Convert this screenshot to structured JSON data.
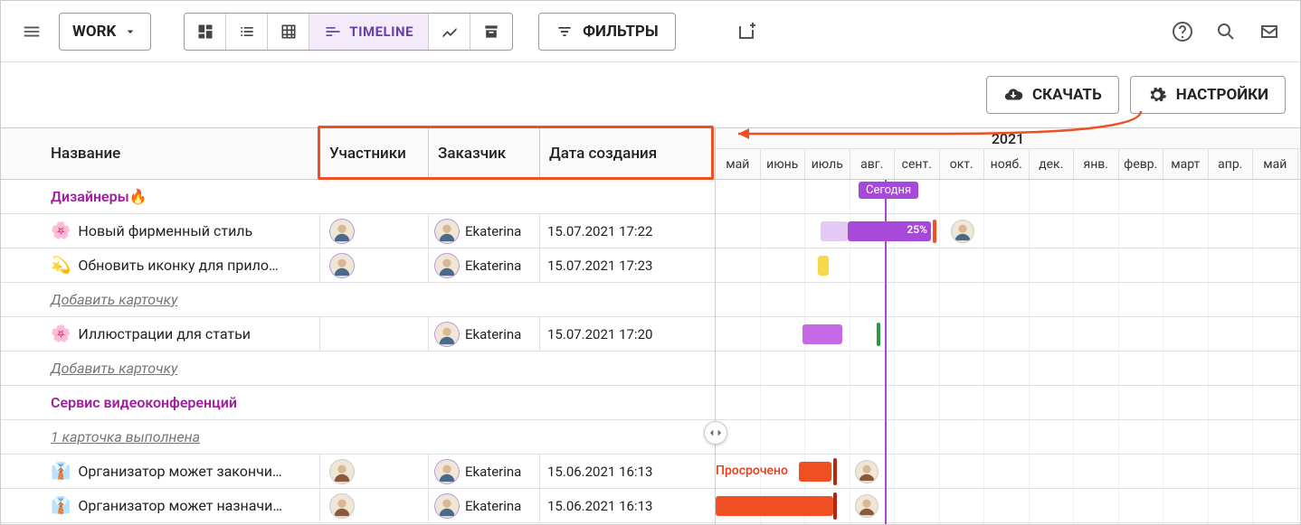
{
  "toolbar": {
    "project": "WORK",
    "timeline_label": "TIMELINE",
    "filters_label": "ФИЛЬТРЫ"
  },
  "actions": {
    "download": "СКАЧАТЬ",
    "settings": "НАСТРОЙКИ"
  },
  "headers": {
    "name": "Название",
    "participants": "Участники",
    "customer": "Заказчик",
    "created": "Дата создания"
  },
  "timeline": {
    "year": "2021",
    "months": [
      "май",
      "июнь",
      "июль",
      "авг.",
      "сент.",
      "окт.",
      "нояб.",
      "дек.",
      "янв.",
      "февр.",
      "март",
      "апр.",
      "май"
    ],
    "today_label": "Сегодня",
    "overdue_label": "Просрочено"
  },
  "sections": {
    "designers": "Дизайнеры🔥",
    "video": "Сервис видеоконференций"
  },
  "add_card": "Добавить карточку",
  "done_card": "1 карточка выполнена",
  "rows": {
    "r1": {
      "emoji": "🌸",
      "title": "Новый фирменный стиль",
      "customer": "Ekaterina",
      "created": "15.07.2021 17:22",
      "progress": "25%"
    },
    "r2": {
      "emoji": "💫",
      "title": "Обновить иконку для прило…",
      "customer": "Ekaterina",
      "created": "15.07.2021 17:23"
    },
    "r3": {
      "emoji": "🌸",
      "title": "Иллюстрации для статьи",
      "customer": "Ekaterina",
      "created": "15.07.2021 17:20"
    },
    "r4": {
      "emoji": "👔",
      "title": "Организатор может закончи…",
      "customer": "Ekaterina",
      "created": "15.06.2021 16:13"
    },
    "r5": {
      "emoji": "👔",
      "title": "Организатор может назначи…",
      "customer": "Ekaterina",
      "created": "15.06.2021 16:13"
    }
  },
  "colors": {
    "purple": "#a648d8",
    "purple_light": "#e5c9f5",
    "orange": "#f04e23",
    "green": "#2a9940",
    "yellow": "#f5d94c"
  }
}
